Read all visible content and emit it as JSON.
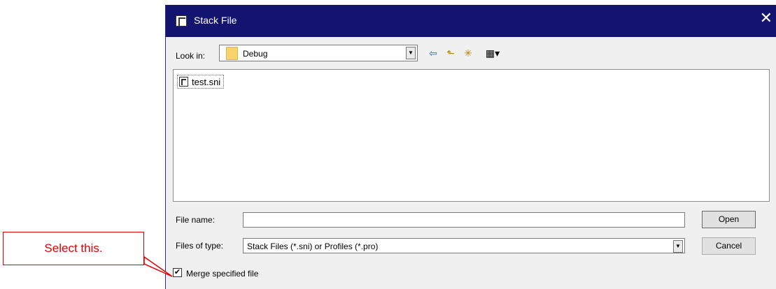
{
  "dialog": {
    "title": "Stack File",
    "close_symbol": "✕"
  },
  "lookin": {
    "label": "Look in:",
    "value": "Debug"
  },
  "toolbar": {
    "back_icon": "⇦",
    "up_icon": "⬑",
    "new_folder_icon": "✳",
    "view_menu_icon": "▦▾"
  },
  "files": [
    {
      "name": "test.sni",
      "icon": "stack-file-icon"
    }
  ],
  "form": {
    "filename_label": "File name:",
    "filename_value": "",
    "filetype_label": "Files of type:",
    "filetype_value": "Stack Files (*.sni) or Profiles (*.pro)",
    "open_label": "Open",
    "cancel_label": "Cancel",
    "merge_label": "Merge specified file",
    "merge_checked": true
  },
  "annotation": {
    "text": "Select this.",
    "color": "#e00000"
  },
  "colors": {
    "titlebar": "#13146f",
    "dialog_bg": "#f0f0f0"
  }
}
